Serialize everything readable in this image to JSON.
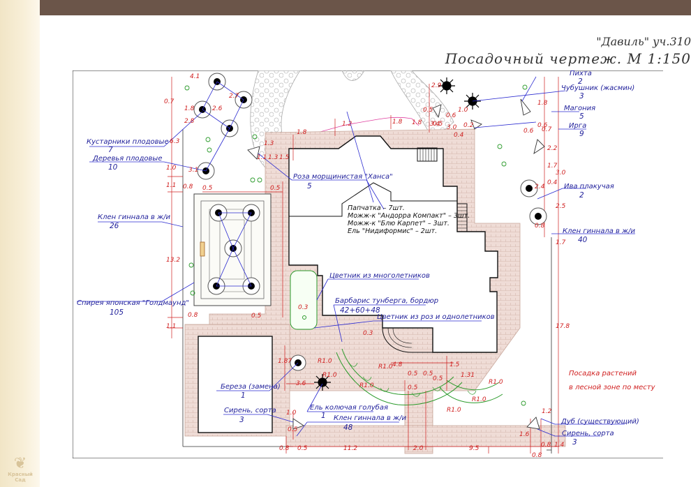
{
  "header": {
    "title_line1": "\"Давиль\" уч.310",
    "title_line2": "Посадочный чертеж. М 1:150"
  },
  "brand": {
    "logo_text": "Красный Сад"
  },
  "colors": {
    "topbar": "#6b5549",
    "sidebar": "#f4e9cf",
    "labels": "#1e1e9a",
    "dimensions": "#d02020",
    "paving": "#ead8d0",
    "lawn_border": "#2a9a2a"
  },
  "labels": [
    {
      "id": "pihta",
      "name": "Пихта",
      "count": "2"
    },
    {
      "id": "chubushnik",
      "name": "Чубушник (жасмин)",
      "count": "3"
    },
    {
      "id": "magonia",
      "name": "Магония",
      "count": "5"
    },
    {
      "id": "irga",
      "name": "Ирга",
      "count": "9"
    },
    {
      "id": "iva",
      "name": "Ива плакучая",
      "count": "2"
    },
    {
      "id": "klen_right",
      "name": "Клен гиннала в ж/и",
      "count": "40"
    },
    {
      "id": "kustarniki",
      "name": "Кустарники плодовые",
      "count": "7"
    },
    {
      "id": "derevya",
      "name": "Деревья плодовые",
      "count": "10"
    },
    {
      "id": "roza",
      "name": "Роза морщинистая \"Ханса\"",
      "count": "5"
    },
    {
      "id": "klen_left",
      "name": "Клен гиннала в ж/и",
      "count": "26"
    },
    {
      "id": "spireya",
      "name": "Спирея японская \"Голдмаунд\"",
      "count": "105"
    },
    {
      "id": "barbaris",
      "name": "Барбарис тунберга, бордюр",
      "count": "42+60+48"
    },
    {
      "id": "bereza",
      "name": "Береза (замена)",
      "count": "1"
    },
    {
      "id": "siren_left",
      "name": "Сирень, сорта",
      "count": "3"
    },
    {
      "id": "el",
      "name": "Ель колючая голубая",
      "count": "1"
    },
    {
      "id": "klen_bottom",
      "name": "Клен гиннала в ж/и",
      "count": "48"
    },
    {
      "id": "dub",
      "name": "Дуб (существующий)",
      "count": ""
    },
    {
      "id": "siren_right",
      "name": "Сирень, сорта",
      "count": "3"
    }
  ],
  "house_notes": [
    "Папчатка – 7шт.",
    "Можж-к \"Андорра Компакт\" – 3шт.",
    "Можж-к \"Блю Карпет\" – 3шт.",
    "Ель \"Нидиформис\" – 2шт."
  ],
  "flower_beds": [
    "Цветник из многолетников",
    "Цветник из роз и однолетников"
  ],
  "notes": {
    "forest_line1": "Посадка растений",
    "forest_line2": "в лесной зоне по месту"
  },
  "dimensions": {
    "top": [
      "4.1",
      "2.7",
      "2.6",
      "1.8",
      "2.8",
      "0.7"
    ],
    "left": [
      "6.3",
      "3.1",
      "0.8",
      "1.1",
      "1.0",
      "0.5",
      "13.2",
      "0.8",
      "1.1"
    ],
    "center": [
      "0.5",
      "1.8",
      "1.2",
      "1.8",
      "1.3",
      "1.8",
      "1.1",
      "1.3",
      "1.5",
      "0.3",
      "0.5"
    ],
    "house": [
      "3.0",
      "1.0",
      "0.6",
      "0.4",
      "0.5",
      "0.2"
    ],
    "right": [
      "2.9",
      "0.6",
      "1.8",
      "3.4",
      "0.5",
      "0.7",
      "0.6",
      "2.2",
      "1.7",
      "3.0",
      "0.4",
      "2.4",
      "2.5",
      "0.8",
      "1.7",
      "17.8",
      "1.2",
      "1.4",
      "1.6",
      "0.8"
    ],
    "radius": [
      "R1.0",
      "R1.0",
      "R1.0",
      "R1.0",
      "R1.0",
      "R1.0",
      "R1.0"
    ],
    "bottom_beds": [
      "0.3",
      "4.8",
      "0.5",
      "0.5",
      "1.5",
      "1.31",
      "0.5",
      "0.5",
      "1.87",
      "3.6",
      "1.0",
      "0.5"
    ],
    "bottom": [
      "0.5",
      "11.2",
      "2.0",
      "9.5",
      "0.8",
      "0.8"
    ]
  }
}
